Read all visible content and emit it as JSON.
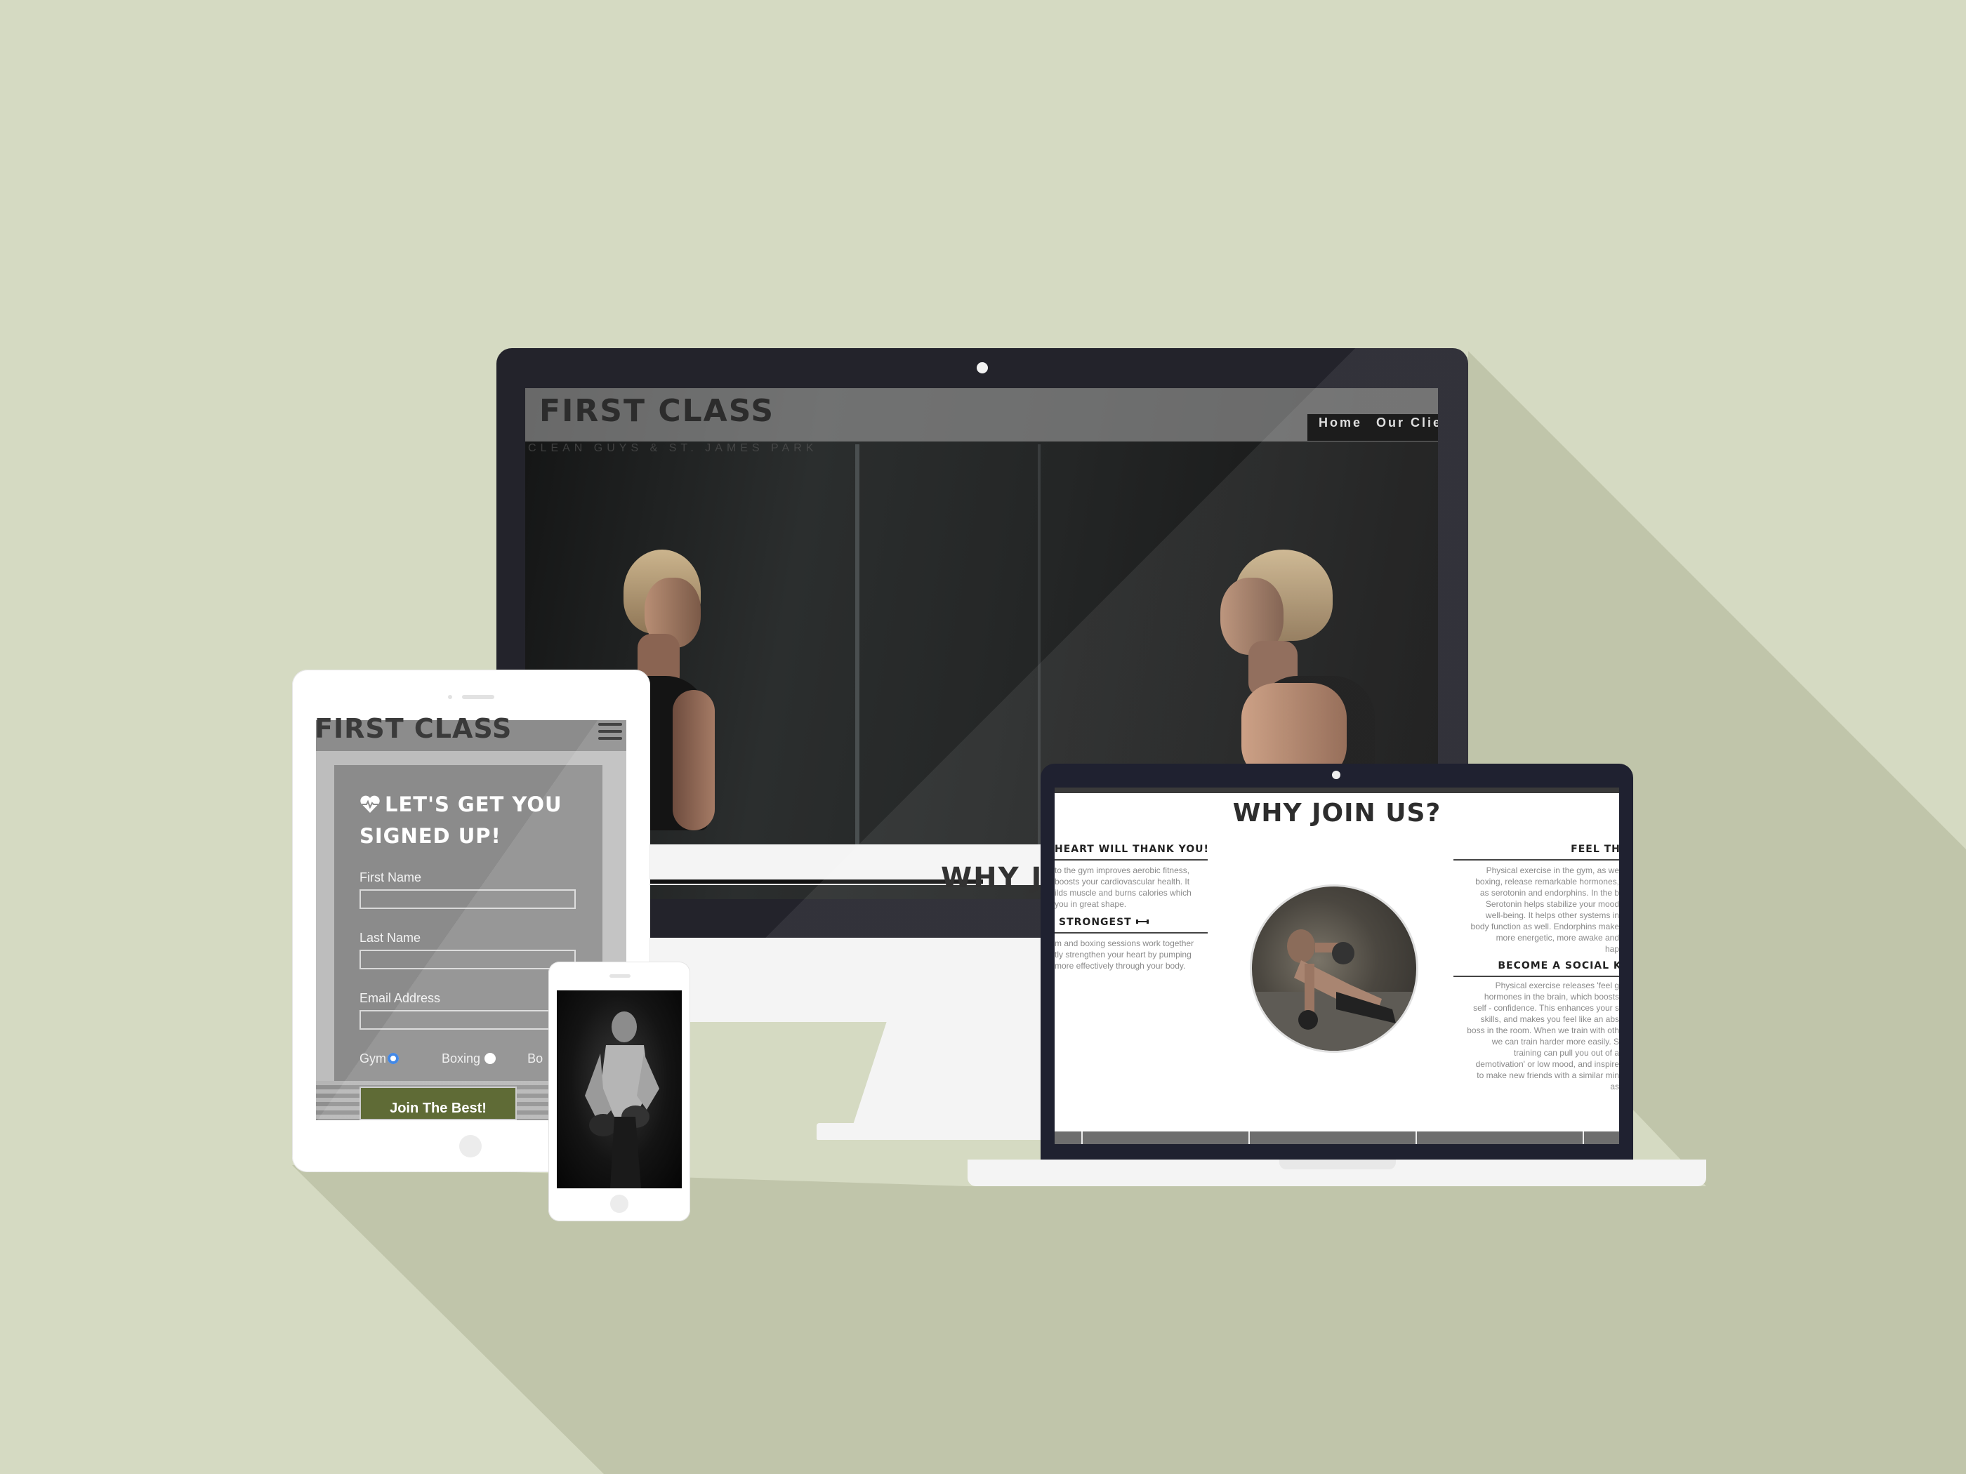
{
  "colors": {
    "background": "#d5dac2",
    "shadow": "#c0c5aa",
    "device_dark": "#23232b",
    "device_light": "#f4f4f4",
    "join_button": "#4d5a1f",
    "radio_accent": "#2e7be2"
  },
  "monitor": {
    "logo": "FIRST CLASS",
    "tagline": "CLEAN GUYS & ST. JAMES PARK",
    "nav": [
      "Home",
      "Our Clients"
    ],
    "section_peek": "WHY JO"
  },
  "laptop": {
    "title": "WHY JOIN US?",
    "left_col": [
      {
        "heading": "HEART WILL THANK YOU!",
        "icon": "heart-icon",
        "lines": [
          "to the gym improves aerobic fitness,",
          "boosts your cardiovascular health. It",
          "ilds muscle and burns calories which",
          "you in great shape."
        ]
      },
      {
        "heading": "STRONGEST",
        "icon": "dumbbell-icon",
        "lines": [
          "m and boxing sessions work together",
          "tly strengthen your heart by pumping",
          "more effectively through your body."
        ]
      }
    ],
    "right_col": [
      {
        "heading": "FEEL THE B",
        "lines": [
          "Physical exercise in the gym, as we",
          "boxing, release remarkable hormones,",
          "as serotonin and endorphins. In the b",
          "Serotonin helps stabilize your mood",
          "well-being. It helps other systems in",
          "body function as well. Endorphins make",
          "more energetic, more awake and",
          "hap"
        ]
      },
      {
        "heading": "BECOME A SOCIAL KI",
        "lines": [
          "Physical exercise releases 'feel g",
          "hormones in the brain, which boosts",
          "self - confidence. This enhances your s",
          "skills, and makes you feel like an abs",
          "boss in the room. When we train with oth",
          "we can train harder more easily. S",
          "training can pull you out of a",
          "demotivation' or low mood, and inspire",
          "to make new friends with a similar min",
          "as"
        ]
      }
    ]
  },
  "tablet": {
    "logo": "FIRST CLASS",
    "form_title": "LET'S GET YOU SIGNED UP!",
    "fields": [
      {
        "label": "First Name",
        "value": ""
      },
      {
        "label": "Last Name",
        "value": ""
      },
      {
        "label": "Email Address",
        "value": ""
      }
    ],
    "radio_options": [
      {
        "label": "Gym",
        "checked": true
      },
      {
        "label": "Boxing",
        "checked": false
      },
      {
        "label": "Bo",
        "checked": false
      }
    ],
    "submit_label": "Join The Best!"
  }
}
